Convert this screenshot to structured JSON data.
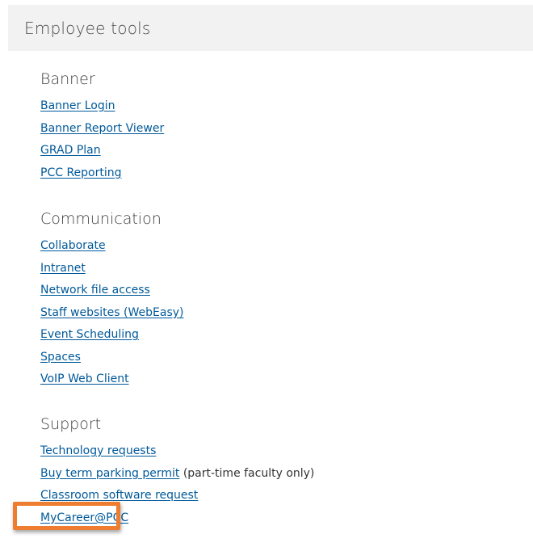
{
  "panel": {
    "title": "Employee tools"
  },
  "sections": {
    "banner": {
      "title": "Banner",
      "links": [
        "Banner Login",
        "Banner Report Viewer",
        "GRAD Plan",
        "PCC Reporting"
      ]
    },
    "communication": {
      "title": "Communication",
      "links": [
        "Collaborate",
        "Intranet",
        "Network file access",
        "Staff websites (WebEasy)",
        "Event Scheduling",
        "Spaces",
        "VoIP Web Client"
      ]
    },
    "support": {
      "title": "Support",
      "links": [
        "Technology requests",
        "Buy term parking permit",
        "Classroom software request",
        "MyCareer@PCC"
      ],
      "parking_note": " (part-time faculty only)"
    }
  },
  "colors": {
    "link": "#00599a",
    "header_bg": "#f2f2f2",
    "highlight": "#ee7d30"
  }
}
